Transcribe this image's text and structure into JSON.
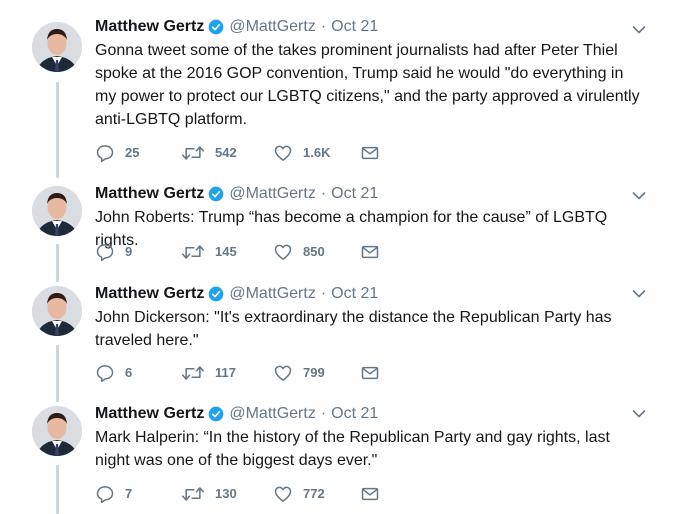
{
  "author": {
    "name": "Matthew Gertz",
    "handle": "@MattGertz",
    "separator": "·"
  },
  "colors": {
    "text": "#14171a",
    "secondary": "#657786",
    "verified": "#1da1f2",
    "thread_line": "#ccd6dd"
  },
  "icons": {
    "reply": "reply-icon",
    "retweet": "retweet-icon",
    "like": "heart-icon",
    "dm": "envelope-icon",
    "verified": "verified-badge-icon",
    "menu": "chevron-down-icon"
  },
  "tweets": [
    {
      "time": "Oct 21",
      "text": "Gonna tweet some of the takes prominent journalists had after Peter Thiel spoke at the 2016 GOP convention, Trump said he would \"do everything in my power to protect our LGBTQ citizens,\" and the party approved a virulently anti-LGBTQ platform.",
      "replies": "25",
      "retweets": "542",
      "likes": "1.6K"
    },
    {
      "time": "Oct 21",
      "text": "John Roberts: Trump “has become a champion for the cause” of LGBTQ rights.",
      "replies": "9",
      "retweets": "145",
      "likes": "850"
    },
    {
      "time": "Oct 21",
      "text": "John Dickerson: \"It's extraordinary the distance the Republican Party has traveled here.\"",
      "replies": "6",
      "retweets": "117",
      "likes": "799"
    },
    {
      "time": "Oct 21",
      "text": "Mark Halperin: “In the history of the Republican Party and gay rights, last night was one of the biggest days ever.\"",
      "replies": "7",
      "retweets": "130",
      "likes": "772"
    }
  ]
}
